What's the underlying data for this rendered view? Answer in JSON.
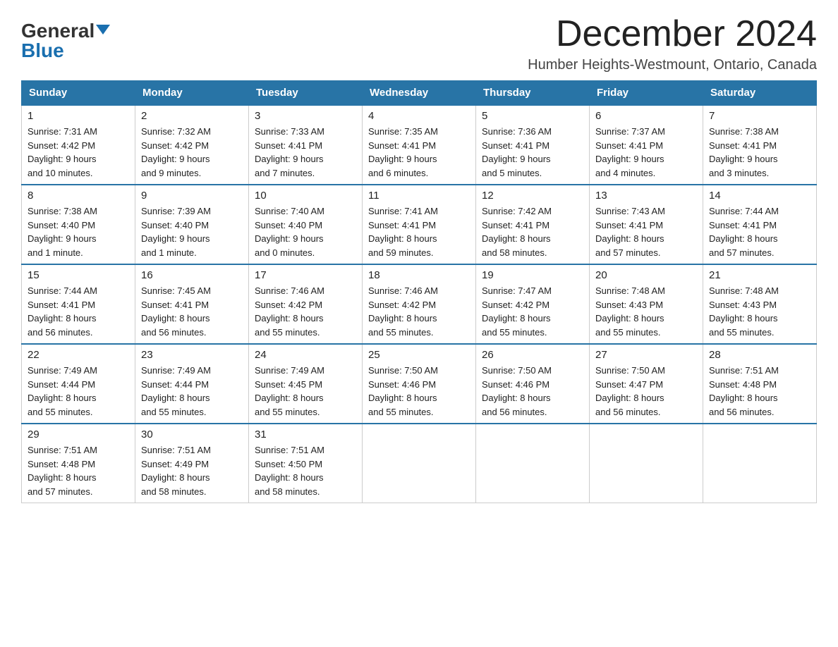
{
  "header": {
    "logo_general": "General",
    "logo_blue": "Blue",
    "month_title": "December 2024",
    "location": "Humber Heights-Westmount, Ontario, Canada"
  },
  "days_of_week": [
    "Sunday",
    "Monday",
    "Tuesday",
    "Wednesday",
    "Thursday",
    "Friday",
    "Saturday"
  ],
  "weeks": [
    [
      {
        "day": "1",
        "sunrise": "7:31 AM",
        "sunset": "4:42 PM",
        "daylight": "9 hours and 10 minutes."
      },
      {
        "day": "2",
        "sunrise": "7:32 AM",
        "sunset": "4:42 PM",
        "daylight": "9 hours and 9 minutes."
      },
      {
        "day": "3",
        "sunrise": "7:33 AM",
        "sunset": "4:41 PM",
        "daylight": "9 hours and 7 minutes."
      },
      {
        "day": "4",
        "sunrise": "7:35 AM",
        "sunset": "4:41 PM",
        "daylight": "9 hours and 6 minutes."
      },
      {
        "day": "5",
        "sunrise": "7:36 AM",
        "sunset": "4:41 PM",
        "daylight": "9 hours and 5 minutes."
      },
      {
        "day": "6",
        "sunrise": "7:37 AM",
        "sunset": "4:41 PM",
        "daylight": "9 hours and 4 minutes."
      },
      {
        "day": "7",
        "sunrise": "7:38 AM",
        "sunset": "4:41 PM",
        "daylight": "9 hours and 3 minutes."
      }
    ],
    [
      {
        "day": "8",
        "sunrise": "7:38 AM",
        "sunset": "4:40 PM",
        "daylight": "9 hours and 1 minute."
      },
      {
        "day": "9",
        "sunrise": "7:39 AM",
        "sunset": "4:40 PM",
        "daylight": "9 hours and 1 minute."
      },
      {
        "day": "10",
        "sunrise": "7:40 AM",
        "sunset": "4:40 PM",
        "daylight": "9 hours and 0 minutes."
      },
      {
        "day": "11",
        "sunrise": "7:41 AM",
        "sunset": "4:41 PM",
        "daylight": "8 hours and 59 minutes."
      },
      {
        "day": "12",
        "sunrise": "7:42 AM",
        "sunset": "4:41 PM",
        "daylight": "8 hours and 58 minutes."
      },
      {
        "day": "13",
        "sunrise": "7:43 AM",
        "sunset": "4:41 PM",
        "daylight": "8 hours and 57 minutes."
      },
      {
        "day": "14",
        "sunrise": "7:44 AM",
        "sunset": "4:41 PM",
        "daylight": "8 hours and 57 minutes."
      }
    ],
    [
      {
        "day": "15",
        "sunrise": "7:44 AM",
        "sunset": "4:41 PM",
        "daylight": "8 hours and 56 minutes."
      },
      {
        "day": "16",
        "sunrise": "7:45 AM",
        "sunset": "4:41 PM",
        "daylight": "8 hours and 56 minutes."
      },
      {
        "day": "17",
        "sunrise": "7:46 AM",
        "sunset": "4:42 PM",
        "daylight": "8 hours and 55 minutes."
      },
      {
        "day": "18",
        "sunrise": "7:46 AM",
        "sunset": "4:42 PM",
        "daylight": "8 hours and 55 minutes."
      },
      {
        "day": "19",
        "sunrise": "7:47 AM",
        "sunset": "4:42 PM",
        "daylight": "8 hours and 55 minutes."
      },
      {
        "day": "20",
        "sunrise": "7:48 AM",
        "sunset": "4:43 PM",
        "daylight": "8 hours and 55 minutes."
      },
      {
        "day": "21",
        "sunrise": "7:48 AM",
        "sunset": "4:43 PM",
        "daylight": "8 hours and 55 minutes."
      }
    ],
    [
      {
        "day": "22",
        "sunrise": "7:49 AM",
        "sunset": "4:44 PM",
        "daylight": "8 hours and 55 minutes."
      },
      {
        "day": "23",
        "sunrise": "7:49 AM",
        "sunset": "4:44 PM",
        "daylight": "8 hours and 55 minutes."
      },
      {
        "day": "24",
        "sunrise": "7:49 AM",
        "sunset": "4:45 PM",
        "daylight": "8 hours and 55 minutes."
      },
      {
        "day": "25",
        "sunrise": "7:50 AM",
        "sunset": "4:46 PM",
        "daylight": "8 hours and 55 minutes."
      },
      {
        "day": "26",
        "sunrise": "7:50 AM",
        "sunset": "4:46 PM",
        "daylight": "8 hours and 56 minutes."
      },
      {
        "day": "27",
        "sunrise": "7:50 AM",
        "sunset": "4:47 PM",
        "daylight": "8 hours and 56 minutes."
      },
      {
        "day": "28",
        "sunrise": "7:51 AM",
        "sunset": "4:48 PM",
        "daylight": "8 hours and 56 minutes."
      }
    ],
    [
      {
        "day": "29",
        "sunrise": "7:51 AM",
        "sunset": "4:48 PM",
        "daylight": "8 hours and 57 minutes."
      },
      {
        "day": "30",
        "sunrise": "7:51 AM",
        "sunset": "4:49 PM",
        "daylight": "8 hours and 58 minutes."
      },
      {
        "day": "31",
        "sunrise": "7:51 AM",
        "sunset": "4:50 PM",
        "daylight": "8 hours and 58 minutes."
      },
      null,
      null,
      null,
      null
    ]
  ]
}
